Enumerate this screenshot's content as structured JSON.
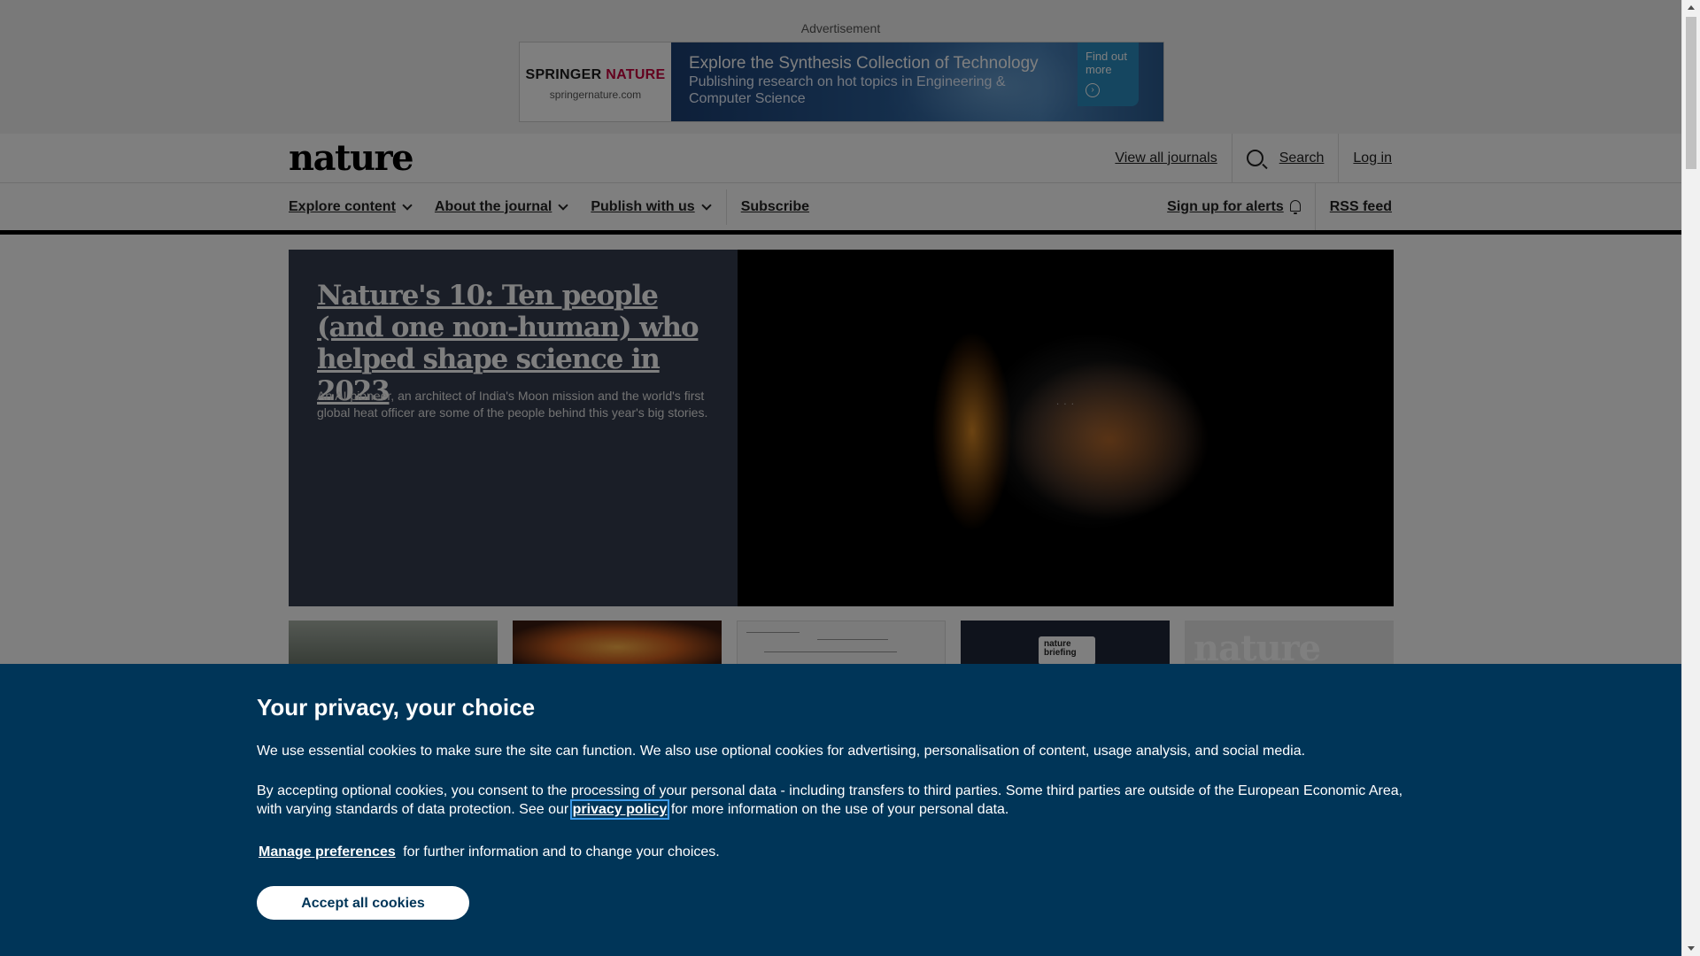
{
  "advertisement": {
    "label": "Advertisement",
    "brand_first": "SPRINGER",
    "brand_second": "NATURE",
    "brand_url": "springernature.com",
    "headline": "Explore the Synthesis Collection of Technology",
    "subline": "Publishing research on hot topics in Engineering & Computer Science",
    "cta": "Find out more",
    "brand_accent": "#c7003d"
  },
  "header": {
    "logo": "nature",
    "view_all_journals": "View all journals",
    "search": "Search",
    "login": "Log in"
  },
  "nav": {
    "explore": "Explore content",
    "about": "About the journal",
    "publish": "Publish with us",
    "subscribe": "Subscribe",
    "alerts": "Sign up for alerts",
    "rss": "RSS feed"
  },
  "hero": {
    "title": "Nature's 10: Ten people (and one non-human) who helped shape science in 2023",
    "description": "An AI pioneer, an architect of India's Moon mission and the world's first global heat officer are some of the people behind this year's big stories."
  },
  "thumbnails": {
    "briefing_badge": "nature briefing",
    "issue_word": "nature"
  },
  "privacy": {
    "title": "Your privacy, your choice",
    "para1": "We use essential cookies to make sure the site can function. We also use optional cookies for advertising, personalisation of content, usage analysis, and social media.",
    "para2_before": "By accepting optional cookies, you consent to the processing of your personal data - including transfers to third parties. Some third parties are outside of the European Economic Area, with varying standards of data protection. See our",
    "privacy_link": "privacy policy",
    "para2_after": "for more information on the use of your personal data.",
    "manage_link": "Manage preferences",
    "para3_after": "for further information and to change your choices.",
    "accept_button": "Accept all cookies",
    "background_color": "#003558"
  }
}
